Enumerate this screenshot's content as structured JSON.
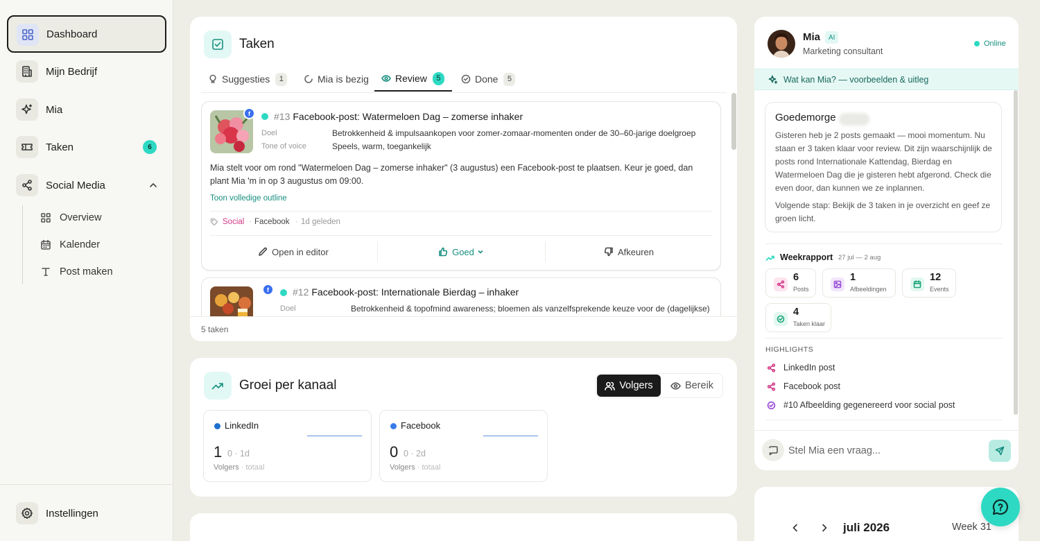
{
  "sidebar": {
    "items": [
      {
        "label": "Dashboard"
      },
      {
        "label": "Mijn Bedrijf"
      },
      {
        "label": "Mia"
      },
      {
        "label": "Taken",
        "badge": "6"
      },
      {
        "label": "Social Media"
      }
    ],
    "sub_items": [
      {
        "label": "Overview"
      },
      {
        "label": "Kalender"
      },
      {
        "label": "Post maken"
      }
    ],
    "settings_label": "Instellingen"
  },
  "tasks": {
    "title": "Taken",
    "tabs": [
      {
        "label": "Suggesties",
        "count": "1",
        "icon": "lightbulb-icon"
      },
      {
        "label": "Mia is bezig",
        "count": "",
        "icon": "spinner-icon"
      },
      {
        "label": "Review",
        "count": "5",
        "icon": "eye-icon",
        "active": true
      },
      {
        "label": "Done",
        "count": "5",
        "icon": "check-circle-icon"
      }
    ],
    "items": [
      {
        "number": "#13",
        "title": "Facebook-post: Watermeloen Dag – zomerse inhaker",
        "goal_label": "Doel",
        "goal": "Betrokkenheid & impulsaankopen voor zomer-zomaar-momenten onder de 30–60-jarige doelgroep",
        "tone_label": "Tone of voice",
        "tone": "Speels, warm, toegankelijk",
        "description": "Mia stelt voor om rond \"Watermeloen Dag – zomerse inhaker\" (3 augustus) een Facebook-post te plaatsen. Keur je goed, dan plant Mia 'm in op 3 augustus om 09:00.",
        "outline_link": "Toon volledige outline",
        "tag": "Social",
        "platform": "Facebook",
        "age": "1d geleden",
        "actions": {
          "open": "Open in editor",
          "approve": "Goed",
          "reject": "Afkeuren"
        }
      },
      {
        "number": "#12",
        "title": "Facebook-post: Internationale Bierdag – inhaker",
        "goal_label": "Doel",
        "goal": "Betrokkenheid & topofmind awareness; bloemen als vanzelfsprekende keuze voor de (dagelijkse)"
      }
    ],
    "footer": "5 taken"
  },
  "growth": {
    "title": "Groei per kanaal",
    "toggle": {
      "followers": "Volgers",
      "reach": "Bereik"
    },
    "channels": [
      {
        "name": "LinkedIn",
        "value": "1",
        "delta": "0 · 1d",
        "label": "Volgers",
        "label_suffix": " · totaal"
      },
      {
        "name": "Facebook",
        "value": "0",
        "delta": "0 · 2d",
        "label": "Volgers",
        "label_suffix": " · totaal"
      }
    ]
  },
  "assistant": {
    "name": "Mia",
    "badge": "AI",
    "role": "Marketing consultant",
    "status": "Online",
    "hint": "Wat kan Mia? — voorbeelden & uitleg",
    "greeting": "Goedemorge",
    "message_1": "Gisteren heb je 2 posts gemaakt — mooi momentum. Nu staan er 3 taken klaar voor review. Dit zijn waarschijnlijk de posts rond Internationale Kattendag, Bierdag en Watermeloen Dag die je gisteren hebt afgerond. Check die even door, dan kunnen we ze inplannen.",
    "message_2": "Volgende stap: Bekijk de 3 taken in je overzicht en geef ze groen licht.",
    "report_title": "Weekrapport",
    "report_range": "27 jul — 2 aug",
    "stats": [
      {
        "value": "6",
        "label": "Posts"
      },
      {
        "value": "1",
        "label": "Afbeeldingen"
      },
      {
        "value": "12",
        "label": "Events"
      },
      {
        "value": "4",
        "label": "Taken klaar"
      }
    ],
    "highlights_title": "HIGHLIGHTS",
    "highlights": [
      {
        "label": "LinkedIn post"
      },
      {
        "label": "Facebook post"
      },
      {
        "label": "#10 Afbeelding gegenereerd voor social post"
      }
    ],
    "ask_placeholder": "Stel Mia een vraag..."
  },
  "calendar": {
    "month": "juli 2026",
    "week": "Week 31"
  },
  "colors": {
    "accent": "#2ed9c3",
    "accent_dark": "#178f80",
    "background": "#eeeee7",
    "social_tag": "#d43b8a",
    "facebook_blue": "#3a6ff0"
  }
}
